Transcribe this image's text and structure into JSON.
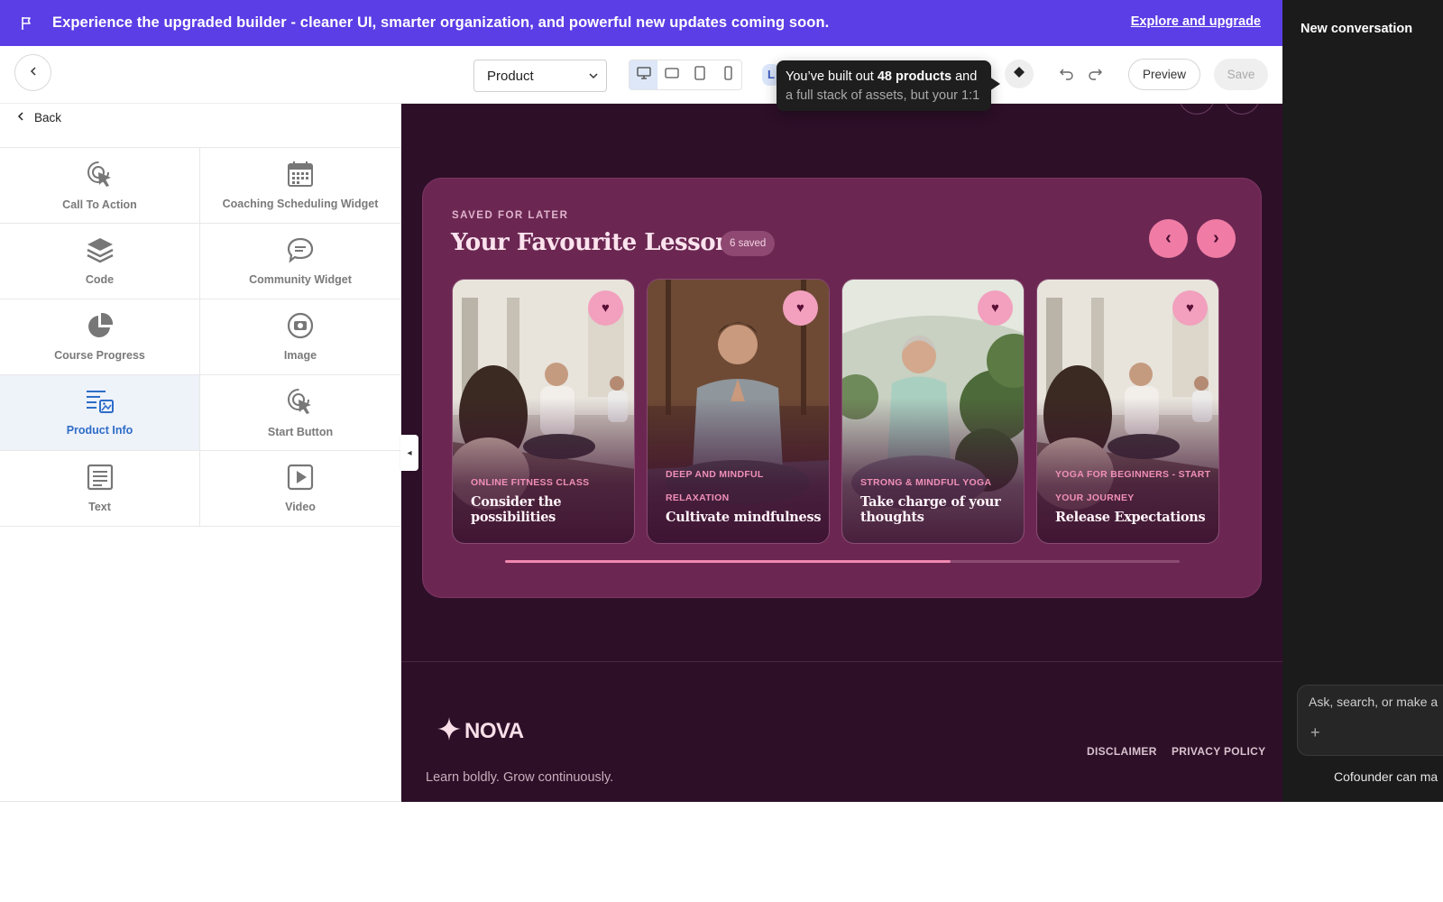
{
  "banner": {
    "text": "Experience the upgraded builder - cleaner UI, smarter organization, and powerful new updates coming soon.",
    "link": "Explore and upgrade",
    "bg_color": "#5b3ee6"
  },
  "toolbar": {
    "page_select": "Product",
    "devices": [
      "desktop-icon",
      "tablet-landscape-icon",
      "tablet-icon",
      "mobile-icon"
    ],
    "active_device": "desktop",
    "pill_letter": "L",
    "tooltip_line1_pre": "You’ve built out ",
    "tooltip_line1_bold": "48 products",
    "tooltip_line1_post": " and",
    "tooltip_line2": "a full stack of assets, but your 1:1",
    "preview_label": "Preview",
    "save_label": "Save"
  },
  "left_panel": {
    "back_label": "Back",
    "widgets": [
      {
        "label": "Call To Action",
        "icon": "cursor-click-icon"
      },
      {
        "label": "Coaching Scheduling Widget",
        "icon": "calendar-icon"
      },
      {
        "label": "Code",
        "icon": "layers-icon"
      },
      {
        "label": "Community Widget",
        "icon": "chat-bubble-icon"
      },
      {
        "label": "Course Progress",
        "icon": "pie-chart-icon"
      },
      {
        "label": "Image",
        "icon": "camera-icon"
      },
      {
        "label": "Product Info",
        "icon": "product-info-icon",
        "selected": true
      },
      {
        "label": "Start Button",
        "icon": "cursor-click-icon"
      },
      {
        "label": "Text",
        "icon": "document-icon"
      },
      {
        "label": "Video",
        "icon": "play-icon"
      }
    ]
  },
  "canvas": {
    "eyebrow": "SAVED FOR LATER",
    "title": "Your Favourite Lessons",
    "saved_badge": "6 saved",
    "prev_icon": "‹",
    "next_icon": "›",
    "lessons": [
      {
        "category": "ONLINE FITNESS CLASS",
        "title": "Consider the possibilities"
      },
      {
        "category": "DEEP AND MINDFUL RELAXATION",
        "title": "Cultivate mindfulness"
      },
      {
        "category": "STRONG & MINDFUL YOGA",
        "title": "Take charge of your thoughts"
      },
      {
        "category": "YOGA FOR BEGINNERS - START YOUR JOURNEY",
        "title": "Release Expectations"
      }
    ],
    "scroll_progress": 0.66,
    "brand": "NOVA",
    "tagline": "Learn boldly. Grow continuously.",
    "footer_links": [
      "DISCLAIMER",
      "PRIVACY POLICY"
    ],
    "colors": {
      "background": "#2d0f28",
      "card": "#6b2752",
      "accent": "#f07ca5"
    }
  },
  "chat": {
    "title": "New conversation",
    "input_placeholder": "Ask, search, or make a",
    "footer": "Cofounder can ma"
  }
}
